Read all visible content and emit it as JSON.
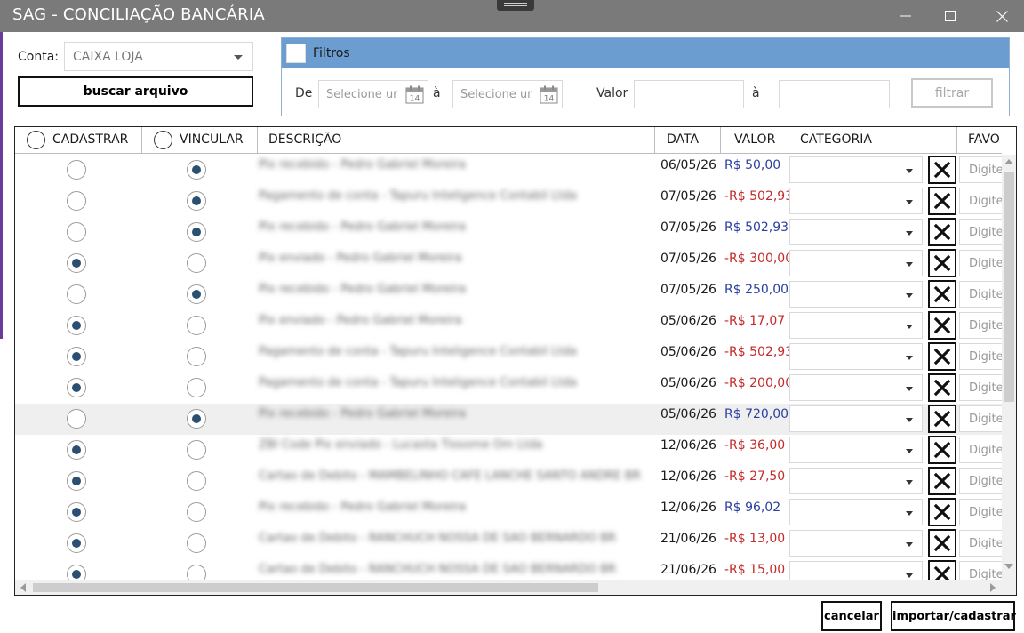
{
  "window": {
    "title": "SAG - CONCILIAÇÃO BANCÁRIA",
    "icons": [
      "minimize-icon",
      "maximize-icon",
      "close-icon"
    ]
  },
  "conta": {
    "label": "Conta:",
    "selected": "CAIXA LOJA"
  },
  "buscar_label": "buscar arquivo",
  "filtros": {
    "title": "Filtros",
    "checked": false,
    "de_label": "De",
    "a_label": "à",
    "date_placeholder": "Selecione uma data",
    "valor_label": "Valor",
    "valor_a_label": "à",
    "filtrar_label": "filtrar",
    "calendar_day": "14"
  },
  "grid": {
    "headers": {
      "cadastrar": "CADASTRAR",
      "vincular": "VINCULAR",
      "descricao": "DESCRIÇÃO",
      "data": "DATA",
      "valor": "VALOR",
      "categoria": "CATEGORIA",
      "favorecido": "FAVO"
    },
    "favorecido_placeholder": "Digite",
    "rows": [
      {
        "mode": "vincular",
        "descricao": "Pix recebido - Pedro Gabriel Moreira",
        "data": "06/05/26",
        "valor": "R$ 50,00",
        "negative": false
      },
      {
        "mode": "vincular",
        "descricao": "Pagamento de conta - Tapuru Inteligence Contabil Ltda",
        "data": "07/05/26",
        "valor": "-R$ 502,93",
        "negative": true
      },
      {
        "mode": "vincular",
        "descricao": "Pix recebido - Pedro Gabriel Moreira",
        "data": "07/05/26",
        "valor": "R$ 502,93",
        "negative": false
      },
      {
        "mode": "cadastrar",
        "descricao": "Pix enviado - Pedro Gabriel Moreira",
        "data": "07/05/26",
        "valor": "-R$ 300,00",
        "negative": true
      },
      {
        "mode": "vincular",
        "descricao": "Pix recebido - Pedro Gabriel Moreira",
        "data": "07/05/26",
        "valor": "R$ 250,00",
        "negative": false
      },
      {
        "mode": "cadastrar",
        "descricao": "Pix enviado - Pedro Gabriel Moreira",
        "data": "05/06/26",
        "valor": "-R$ 17,07",
        "negative": true
      },
      {
        "mode": "cadastrar",
        "descricao": "Pagamento de conta - Tapuru Inteligence Contabil Ltda",
        "data": "05/06/26",
        "valor": "-R$ 502,93",
        "negative": true
      },
      {
        "mode": "cadastrar",
        "descricao": "Pagamento de conta - Tapuru Inteligence Contabil Ltda",
        "data": "05/06/26",
        "valor": "-R$ 200,00",
        "negative": true
      },
      {
        "mode": "vincular",
        "descricao": "Pix recebido - Pedro Gabriel Moreira",
        "data": "05/06/26",
        "valor": "R$ 720,00",
        "negative": false,
        "selected": true
      },
      {
        "mode": "cadastrar",
        "descricao": "ZBI Code Pix enviado - Lucasta Tiosome Om Ltda",
        "data": "12/06/26",
        "valor": "-R$ 36,00",
        "negative": true
      },
      {
        "mode": "cadastrar",
        "descricao": "Cartao de Debito - MAMBELINHO CAFE LANCHE SANTO ANDRE BR",
        "data": "12/06/26",
        "valor": "-R$ 27,50",
        "negative": true
      },
      {
        "mode": "cadastrar",
        "descricao": "Pix recebido - Pedro Gabriel Moreira",
        "data": "12/06/26",
        "valor": "R$ 96,02",
        "negative": false
      },
      {
        "mode": "cadastrar",
        "descricao": "Cartao de Debito - RANCHUCH NOSSA DE SAO BERNARDO BR",
        "data": "21/06/26",
        "valor": "-R$ 13,00",
        "negative": true
      },
      {
        "mode": "cadastrar",
        "descricao": "Cartao de Debito - RANCHUCH NOSSA DE SAO BERNARDO BR",
        "data": "21/06/26",
        "valor": "-R$ 15,00",
        "negative": true
      }
    ]
  },
  "actions": {
    "cancelar": "cancelar",
    "importar": "importar/cadastrar"
  }
}
